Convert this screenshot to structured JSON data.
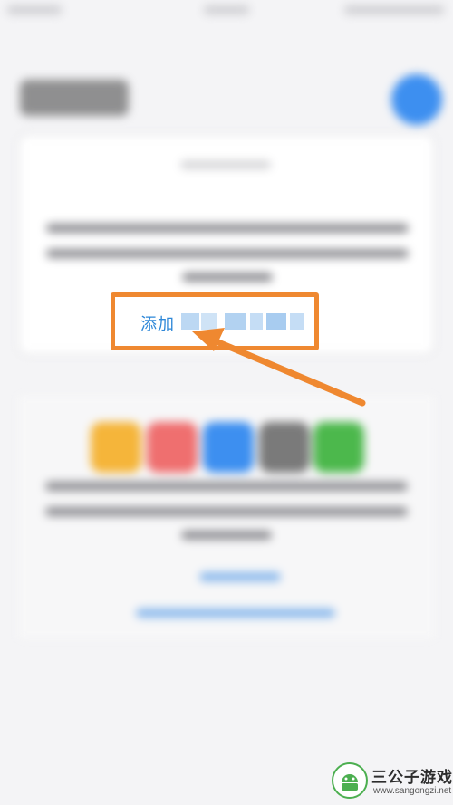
{
  "overlay": {
    "add_link_label": "添加",
    "highlight_color": "#ef8830",
    "link_color": "#2f88d8"
  },
  "watermark": {
    "title": "三公子游戏网",
    "url": "www.sangongzi.net"
  },
  "colors": {
    "background": "#f4f4f6",
    "avatar": "#3d8ff0",
    "app_tiles": [
      "#f5b53a",
      "#ef6f6f",
      "#3d8ff0",
      "#7a7a7a",
      "#4cb84c"
    ]
  }
}
